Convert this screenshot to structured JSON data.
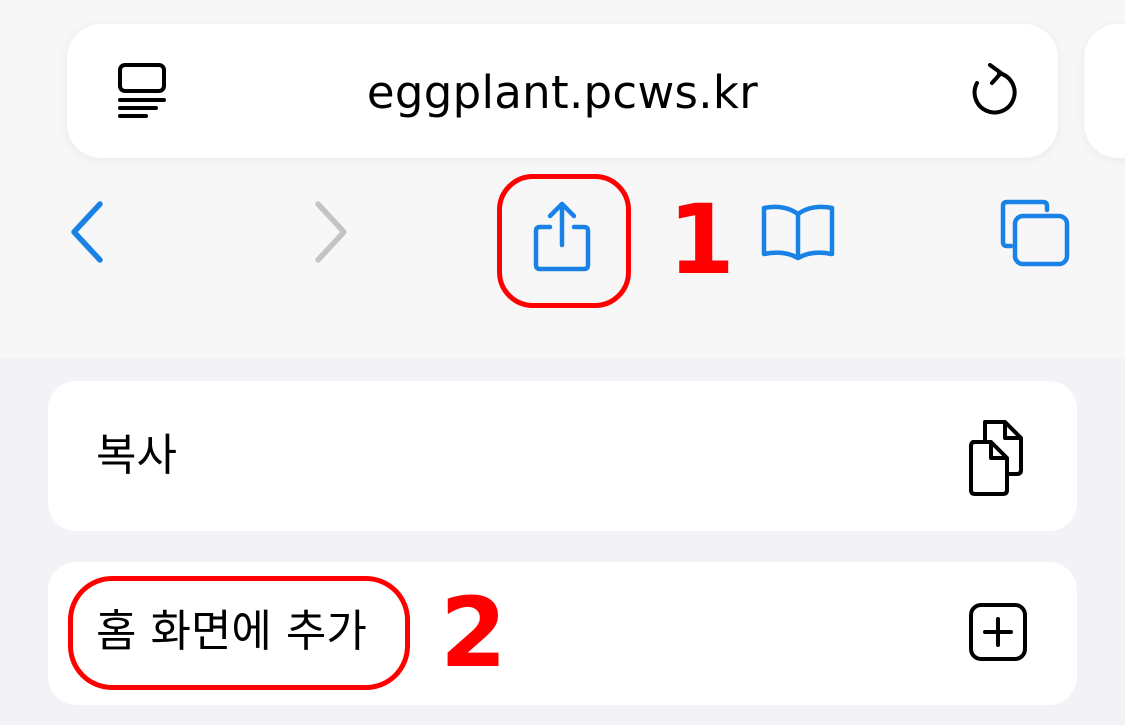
{
  "address_bar": {
    "url": "eggplant.pcws.kr",
    "reader_icon": "reader-mode-icon",
    "reload_icon": "reload-icon"
  },
  "toolbar": {
    "back_icon": "chevron-left-icon",
    "forward_icon": "chevron-right-icon",
    "share_icon": "share-icon",
    "bookmarks_icon": "book-icon",
    "tabs_icon": "tabs-icon"
  },
  "share_menu": {
    "items": [
      {
        "label": "복사",
        "icon": "copy-icon"
      },
      {
        "label": "홈 화면에 추가",
        "icon": "add-square-icon"
      }
    ]
  },
  "annotations": {
    "step1": "1",
    "step2": "2",
    "highlight_color": "#ff0000"
  },
  "colors": {
    "accent": "#1a82e6",
    "disabled": "#c4c4c6",
    "background": "#f2f2f7"
  }
}
